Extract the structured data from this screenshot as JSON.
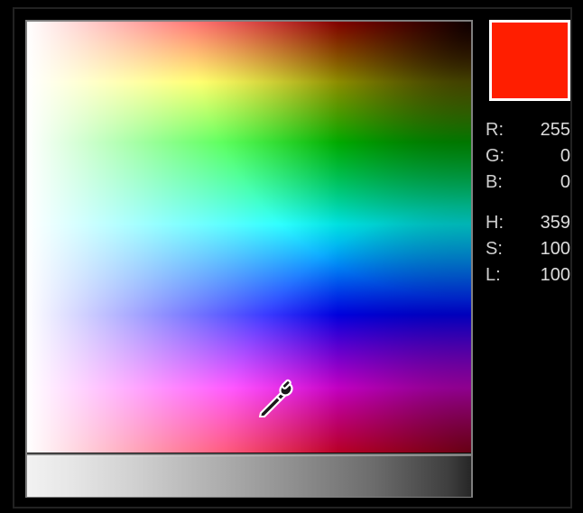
{
  "swatch_color": "#ff1e00",
  "rgb": {
    "r_label": "R:",
    "g_label": "G:",
    "b_label": "B:",
    "r": "255",
    "g": "0",
    "b": "0"
  },
  "hsl": {
    "h_label": "H:",
    "s_label": "S:",
    "l_label": "L:",
    "h": "359",
    "s": "100",
    "l": "100"
  }
}
